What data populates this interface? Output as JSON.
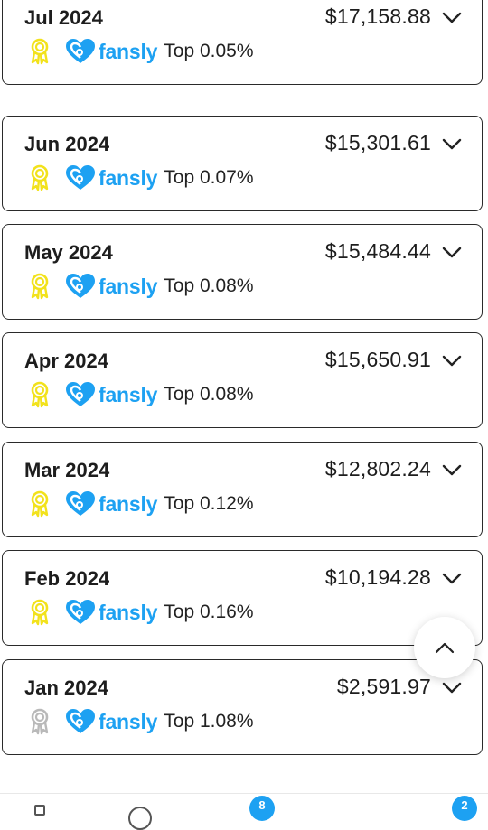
{
  "earnings": [
    {
      "month": "Jul 2024",
      "amount": "$17,158.88",
      "platform": "fansly",
      "rank": "Top 0.05%",
      "award_color": "#f2e21c"
    },
    {
      "month": "Jun 2024",
      "amount": "$15,301.61",
      "platform": "fansly",
      "rank": "Top 0.07%",
      "award_color": "#f2e21c"
    },
    {
      "month": "May 2024",
      "amount": "$15,484.44",
      "platform": "fansly",
      "rank": "Top 0.08%",
      "award_color": "#f2e21c"
    },
    {
      "month": "Apr 2024",
      "amount": "$15,650.91",
      "platform": "fansly",
      "rank": "Top 0.08%",
      "award_color": "#f2e21c"
    },
    {
      "month": "Mar 2024",
      "amount": "$12,802.24",
      "platform": "fansly",
      "rank": "Top 0.12%",
      "award_color": "#f2e21c"
    },
    {
      "month": "Feb 2024",
      "amount": "$10,194.28",
      "platform": "fansly",
      "rank": "Top 0.16%",
      "award_color": "#f2e21c"
    },
    {
      "month": "Jan 2024",
      "amount": "$2,591.97",
      "platform": "fansly",
      "rank": "Top 1.08%",
      "award_color": "#b9b9b9"
    }
  ],
  "icons": {
    "award": "award-ribbon-icon",
    "brand": "fansly-heart-icon",
    "expand": "chevron-down-icon",
    "scroll_top": "chevron-up-icon"
  },
  "colors": {
    "brand": "#1da1f2",
    "gold": "#f2e21c",
    "silver": "#b9b9b9"
  },
  "bottom_nav": {
    "badge_1": "8",
    "badge_2": "2"
  }
}
